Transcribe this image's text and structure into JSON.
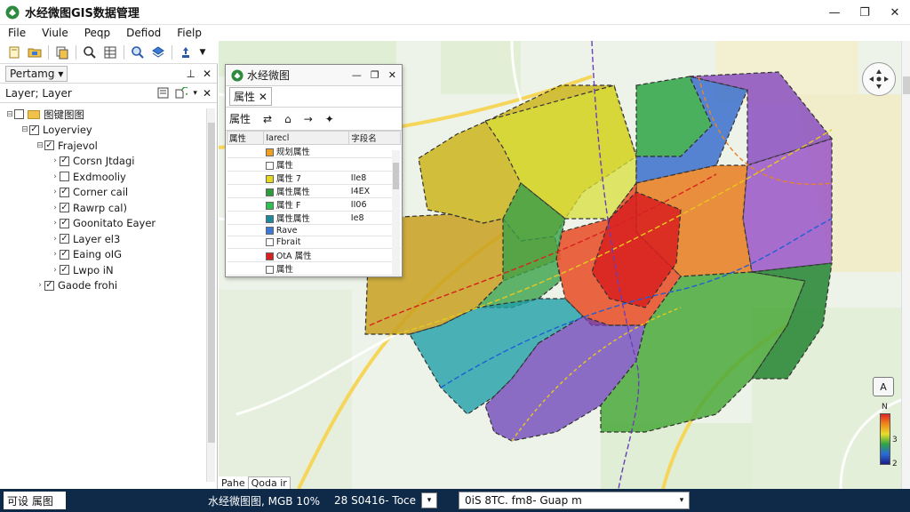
{
  "window": {
    "title": "水经微图GIS数据管理",
    "minimize_glyph": "—",
    "maximize_glyph": "❐",
    "close_glyph": "✕"
  },
  "menu": {
    "items": [
      "File",
      "Viule",
      "Peqp",
      "Defiod",
      "Fielp"
    ]
  },
  "left_panel": {
    "tab_label": "Pertamg",
    "tab_dropdown": "▾",
    "pin_glyph": "⊥",
    "close_glyph": "✕",
    "layer_header_label": "Layer; Layer",
    "tree": [
      {
        "label": "图键图图",
        "checked": false,
        "level": 0,
        "type": "folder",
        "expanded": true
      },
      {
        "label": "Loyerviey",
        "checked": true,
        "level": 1,
        "type": "layer",
        "expanded": true
      },
      {
        "label": "Frajevol",
        "checked": true,
        "level": 2,
        "type": "layer",
        "expanded": true
      },
      {
        "label": "Corsn Jtdagi",
        "checked": true,
        "level": 3,
        "type": "layer",
        "expanded": false
      },
      {
        "label": "Exdmooliy",
        "checked": false,
        "level": 3,
        "type": "layer",
        "expanded": false
      },
      {
        "label": "Corner cail",
        "checked": true,
        "level": 3,
        "type": "layer",
        "expanded": false
      },
      {
        "label": "Rawrp cal)",
        "checked": true,
        "level": 3,
        "type": "layer",
        "expanded": false
      },
      {
        "label": "Goonitato Eayer",
        "checked": true,
        "level": 3,
        "type": "layer",
        "expanded": false
      },
      {
        "label": "Layer el3",
        "checked": true,
        "level": 3,
        "type": "layer",
        "expanded": false
      },
      {
        "label": "Eaing oIG",
        "checked": true,
        "level": 3,
        "type": "layer",
        "expanded": false
      },
      {
        "label": "Lwpo iN",
        "checked": true,
        "level": 3,
        "type": "layer",
        "expanded": false
      },
      {
        "label": "Gaode frohi",
        "checked": true,
        "level": 2,
        "type": "layer",
        "expanded": false
      }
    ]
  },
  "attribute_window": {
    "title": "水经微图",
    "tab_label": "属性",
    "tab_close": "✕",
    "tool_label": "属性",
    "columns": [
      "属性",
      "Iarecl",
      "字段名"
    ],
    "rows": [
      {
        "name": "规划属性",
        "value": "",
        "color": "#f0a020"
      },
      {
        "name": "属性",
        "value": "",
        "color": "#ffffff"
      },
      {
        "name": "属性 7",
        "value": "IIe8",
        "color": "#e6d820"
      },
      {
        "name": "属性属性",
        "value": "I4EX",
        "color": "#2e9c3a"
      },
      {
        "name": "属性 F",
        "value": "II06",
        "color": "#2ec050"
      },
      {
        "name": "属性属性",
        "value": "Ie8",
        "color": "#1c8a9c"
      },
      {
        "name": "Rave",
        "value": "",
        "color": "#3a7ad6"
      },
      {
        "name": "Fbrait",
        "value": "",
        "color": "#ffffff"
      },
      {
        "name": "OtA 属性",
        "value": "",
        "color": "#d82020"
      },
      {
        "name": "属性",
        "value": "",
        "color": "#ffffff"
      }
    ]
  },
  "map": {
    "north_label": "A",
    "legend_top": "N",
    "legend_mid": "3",
    "legend_bottom": "2",
    "tabs": [
      "Pahe",
      "Qoda ir"
    ]
  },
  "status": {
    "left_label": "可设 属图",
    "coords": "水经微图图, MGB 10%",
    "scale": "28 S0416- Toce",
    "combo_value": "0iS 8TC. fm8- Guap m",
    "dropdown_glyph": "▾"
  }
}
